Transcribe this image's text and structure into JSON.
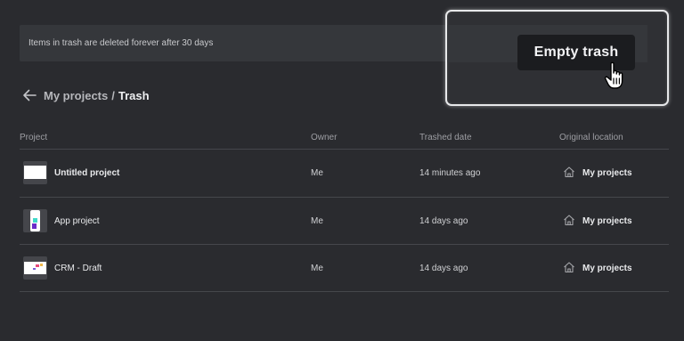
{
  "banner": {
    "text": "Items in trash are deleted forever after 30 days",
    "empty_trash_label": "Empty trash"
  },
  "breadcrumb": {
    "back_icon": "arrow-left-icon",
    "parent": "My projects",
    "separator": "/",
    "current": "Trash"
  },
  "table": {
    "columns": [
      "Project",
      "Owner",
      "Trashed date",
      "Original location"
    ],
    "rows": [
      {
        "name": "Untitled project",
        "owner": "Me",
        "trashed": "14 minutes ago",
        "location": "My projects",
        "location_icon": "home-icon",
        "thumbnail": "blank-page-thumbnail"
      },
      {
        "name": "App project",
        "owner": "Me",
        "trashed": "14 days ago",
        "location": "My projects",
        "location_icon": "home-icon",
        "thumbnail": "phone-app-thumbnail"
      },
      {
        "name": "CRM - Draft",
        "owner": "Me",
        "trashed": "14 days ago",
        "location": "My projects",
        "location_icon": "home-icon",
        "thumbnail": "crm-page-thumbnail"
      }
    ]
  },
  "colors": {
    "background": "#2a2b2f",
    "banner": "#35373b",
    "button": "#1b1c1f",
    "highlight_border": "#e7e8ea"
  }
}
